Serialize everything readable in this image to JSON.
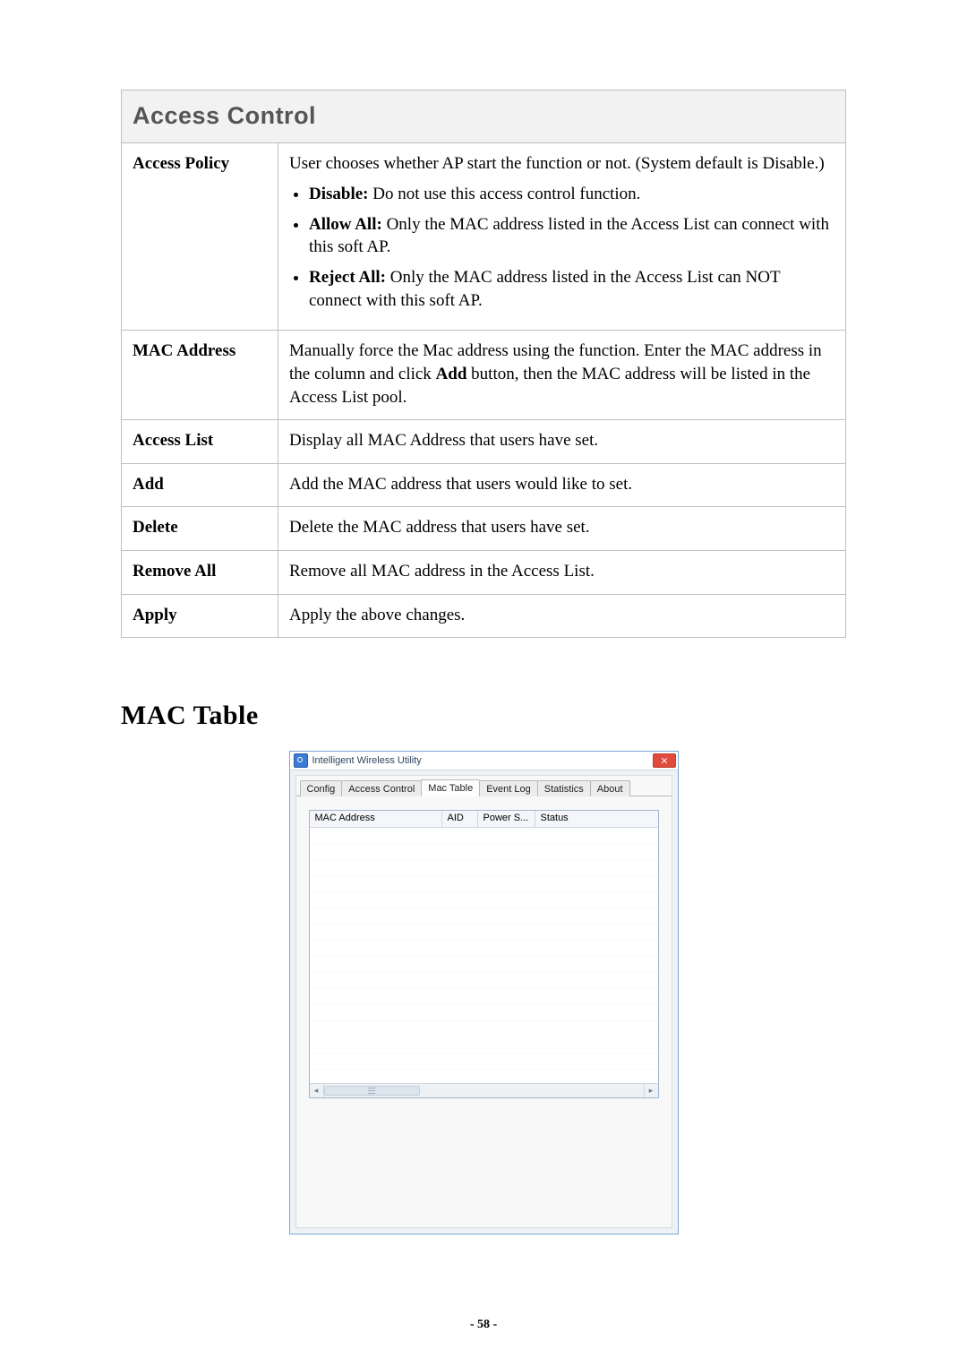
{
  "access_control": {
    "title": "Access Control",
    "rows": [
      {
        "label": "Access Policy",
        "desc_intro": "User chooses whether AP start the function or not. (System default is Disable.)",
        "bullets": [
          {
            "strong": "Disable:",
            "text": " Do not use this access control function."
          },
          {
            "strong": "Allow All:",
            "text": " Only the MAC address listed in the Access List can connect with this soft AP."
          },
          {
            "strong": "Reject All:",
            "text": " Only the MAC address listed in the Access List can NOT connect with this soft AP."
          }
        ]
      },
      {
        "label": "MAC Address",
        "desc_parts": {
          "pre": "Manually force the Mac address using the function. Enter the MAC address in the column and click ",
          "bold": "Add",
          "post": " button, then the MAC address will be listed in the Access List pool."
        }
      },
      {
        "label": "Access List",
        "desc": "Display all MAC Address that users have set."
      },
      {
        "label": "Add",
        "desc": "Add the MAC address that users would like to set."
      },
      {
        "label": "Delete",
        "desc": "Delete the MAC address that users have set."
      },
      {
        "label": "Remove All",
        "desc": "Remove all MAC address in the Access List."
      },
      {
        "label": "Apply",
        "desc": "Apply the above changes."
      }
    ]
  },
  "mac_table_heading": "MAC Table",
  "screenshot": {
    "app_title": "Intelligent Wireless Utility",
    "tabs": [
      "Config",
      "Access Control",
      "Mac Table",
      "Event Log",
      "Statistics",
      "About"
    ],
    "active_tab_index": 2,
    "columns": [
      "MAC Address",
      "AID",
      "Power S...",
      "Status"
    ]
  },
  "page_number": "- 58 -"
}
